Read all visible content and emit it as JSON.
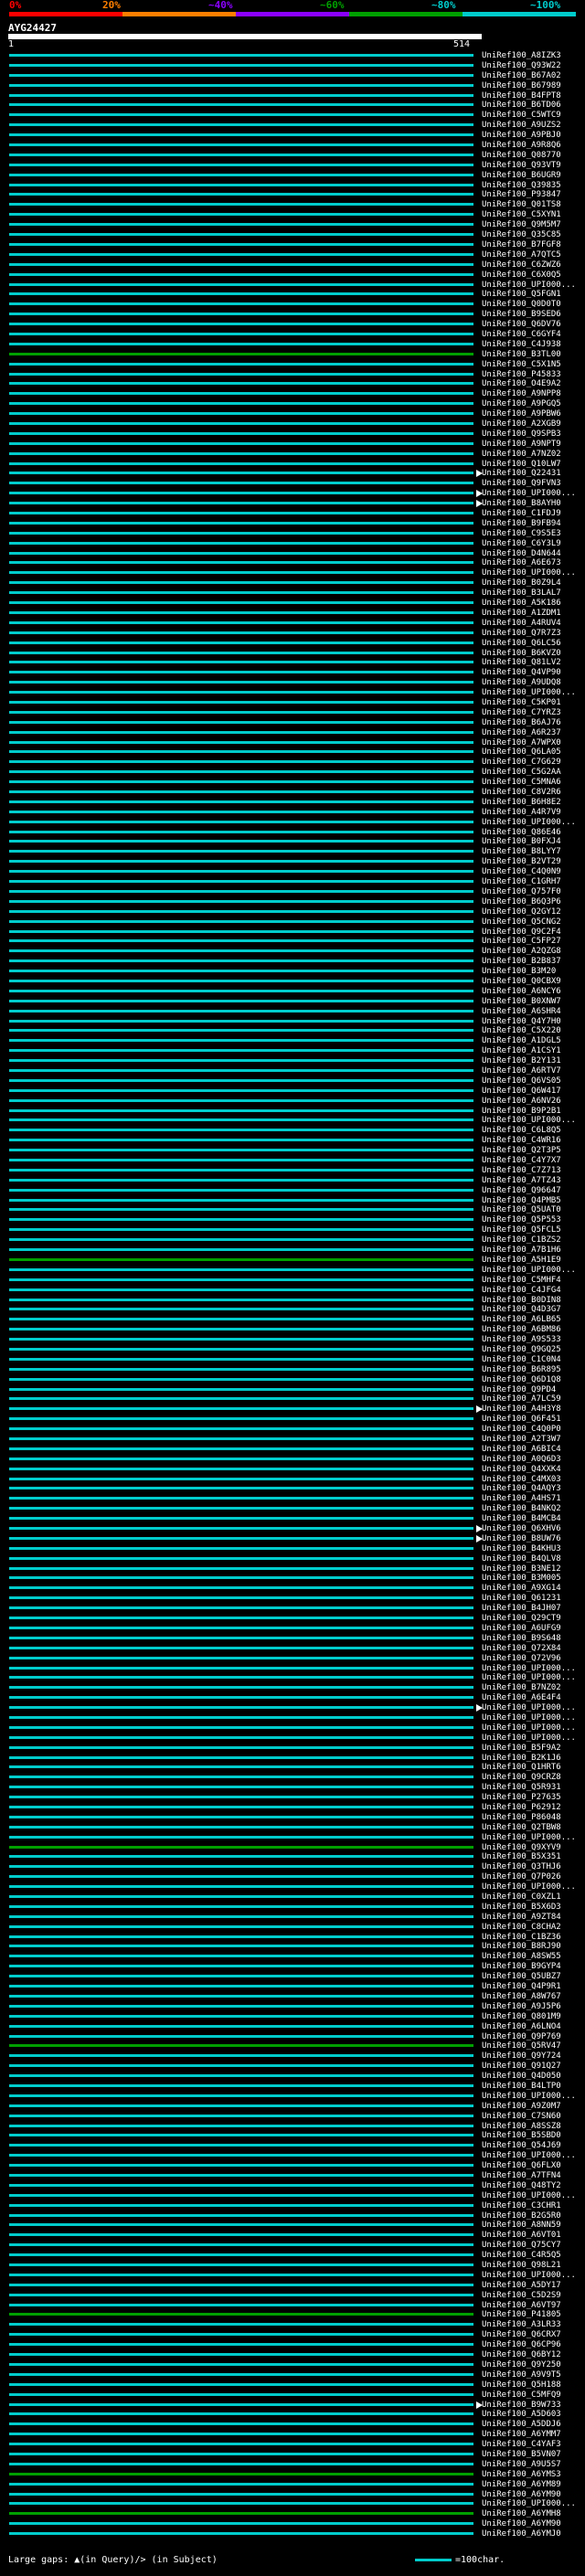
{
  "scale": {
    "labels": [
      "0%",
      "20%",
      "~40%",
      "~60%",
      "~80%",
      "~100%"
    ],
    "colors": [
      "#ff0000",
      "#ff7f00",
      "#8b00ff",
      "#00a000",
      "#00cccc"
    ]
  },
  "query": {
    "id": "AYG24427",
    "start": "1",
    "end": "514"
  },
  "hits": [
    "UniRef100_A8IZK3",
    "UniRef100_Q93W22",
    "UniRef100_B67A02",
    "UniRef100_B67989",
    "UniRef100_B4FPT8",
    "UniRef100_B6TD06",
    "UniRef100_C5WTC9",
    "UniRef100_A9UZS2",
    "UniRef100_A9PBJ0",
    "UniRef100_A9R8Q6",
    "UniRef100_Q08770",
    "UniRef100_Q93VT9",
    "UniRef100_B6UGR9",
    "UniRef100_Q39835",
    "UniRef100_P93847",
    "UniRef100_Q01TS8",
    "UniRef100_C5XYN1",
    "UniRef100_Q9M5M7",
    "UniRef100_Q35C85",
    "UniRef100_B7FGF8",
    "UniRef100_A7QTC5",
    "UniRef100_C6ZWZ6",
    "UniRef100_C6X0Q5",
    "UniRef100_UPI000...",
    "UniRef100_Q5FGN1",
    "UniRef100_Q0D0T0",
    "UniRef100_B9SED6",
    "UniRef100_Q6DV76",
    "UniRef100_C6GYF4",
    "UniRef100_C4J938",
    "UniRef100_B3TL00",
    "UniRef100_C5X1N5",
    "UniRef100_P45833",
    "UniRef100_O4E9A2",
    "UniRef100_A9NPP8",
    "UniRef100_A9PGQ5",
    "UniRef100_A9PBW6",
    "UniRef100_A2XGB9",
    "UniRef100_Q9SPB3",
    "UniRef100_A9NPT9",
    "UniRef100_A7NZ02",
    "UniRef100_Q10LW7",
    "UniRef100_Q22431",
    "UniRef100_Q9FVN3",
    "UniRef100_UPI000...",
    "UniRef100_B8AYH0",
    "UniRef100_C1FDJ9",
    "UniRef100_B9FB94",
    "UniRef100_C9S5E3",
    "UniRef100_C6Y3L9",
    "UniRef100_D4N644",
    "UniRef100_A6E673",
    "UniRef100_UPI000...",
    "UniRef100_B0Z9L4",
    "UniRef100_B3LAL7",
    "UniRef100_A5K186",
    "UniRef100_A1ZDM1",
    "UniRef100_A4RUV4",
    "UniRef100_Q7R7Z3",
    "UniRef100_Q6LC56",
    "UniRef100_B6KVZ0",
    "UniRef100_Q81LV2",
    "UniRef100_Q4VP90",
    "UniRef100_A9UDQ8",
    "UniRef100_UPI000...",
    "UniRef100_C5KP01",
    "UniRef100_C7YRZ3",
    "UniRef100_B6AJ76",
    "UniRef100_A6R237",
    "UniRef100_A7WPX0",
    "UniRef100_Q6LA05",
    "UniRef100_C7G629",
    "UniRef100_C5G2AA",
    "UniRef100_C5MNA6",
    "UniRef100_C8V2R6",
    "UniRef100_B6H8E2",
    "UniRef100_A4R7V9",
    "UniRef100_UPI000...",
    "UniRef100_Q86E46",
    "UniRef100_B0FXJ4",
    "UniRef100_B8LYY7",
    "UniRef100_B2VT29",
    "UniRef100_C4Q0N9",
    "UniRef100_C1GRH7",
    "UniRef100_Q757F0",
    "UniRef100_B6Q3P6",
    "UniRef100_Q2GY12",
    "UniRef100_Q5CNG2",
    "UniRef100_Q9C2F4",
    "UniRef100_C5FP27",
    "UniRef100_A2QZG8",
    "UniRef100_B2B837",
    "UniRef100_B3M20",
    "UniRef100_Q0CBX9",
    "UniRef100_A6NCY6",
    "UniRef100_B0XNW7",
    "UniRef100_A6SHR4",
    "UniRef100_Q4Y7H0",
    "UniRef100_C5X220",
    "UniRef100_A1DGL5",
    "UniRef100_A1CSY1",
    "UniRef100_B2Y131",
    "UniRef100_A6RTV7",
    "UniRef100_Q6VS05",
    "UniRef100_Q6W417",
    "UniRef100_A6NV26",
    "UniRef100_B9P2B1",
    "UniRef100_UPI000...",
    "UniRef100_C6L8Q5",
    "UniRef100_C4WR16",
    "UniRef100_Q2T3P5",
    "UniRef100_C4Y7X7",
    "UniRef100_C7Z713",
    "UniRef100_A7TZ43",
    "UniRef100_Q96647",
    "UniRef100_Q4PMB5",
    "UniRef100_Q5UAT0",
    "UniRef100_Q5P553",
    "UniRef100_Q5FCL5",
    "UniRef100_C1BZS2",
    "UniRef100_A7B1H6",
    "UniRef100_A5H1E9",
    "UniRef100_UPI000...",
    "UniRef100_C5MHF4",
    "UniRef100_C4JFG4",
    "UniRef100_B0DIN8",
    "UniRef100_Q4D3G7",
    "UniRef100_A6LB65",
    "UniRef100_A6BM86",
    "UniRef100_A9S533",
    "UniRef100_Q9GQ25",
    "UniRef100_C1C0N4",
    "UniRef100_B6R895",
    "UniRef100_Q6D1Q8",
    "UniRef100_Q9PD4",
    "UniRef100_A7LC59",
    "UniRef100_A4H3Y8",
    "UniRef100_Q6F451",
    "UniRef100_C4Q0P0",
    "UniRef100_A2T3W7",
    "UniRef100_A6BIC4",
    "UniRef100_A0Q6D3",
    "UniRef100_Q4XXK4",
    "UniRef100_C4MX03",
    "UniRef100_Q4AQY3",
    "UniRef100_A4HS71",
    "UniRef100_B4NKQ2",
    "UniRef100_B4MCB4",
    "UniRef100_Q6XHV6",
    "UniRef100_B8UW76",
    "UniRef100_B4KHU3",
    "UniRef100_B4QLV8",
    "UniRef100_B3NE12",
    "UniRef100_B3M005",
    "UniRef100_A9XG14",
    "UniRef100_Q61231",
    "UniRef100_B4JH07",
    "UniRef100_Q29CT9",
    "UniRef100_A6UFG9",
    "UniRef100_B9S648",
    "UniRef100_Q72X84",
    "UniRef100_Q72V96",
    "UniRef100_UPI000...",
    "UniRef100_UPI000...",
    "UniRef100_B7NZ02",
    "UniRef100_A6E4F4",
    "UniRef100_UPI000...",
    "UniRef100_UPI000...",
    "UniRef100_UPI000...",
    "UniRef100_UPI000...",
    "UniRef100_B5F9A2",
    "UniRef100_B2K1J6",
    "UniRef100_Q1HRT6",
    "UniRef100_Q9CRZ8",
    "UniRef100_Q5R931",
    "UniRef100_P27635",
    "UniRef100_P62912",
    "UniRef100_P86048",
    "UniRef100_Q2TBW8",
    "UniRef100_UPI000...",
    "UniRef100_Q9XYV9",
    "UniRef100_B5X351",
    "UniRef100_Q3THJ6",
    "UniRef100_Q7P026",
    "UniRef100_UPI000...",
    "UniRef100_C0XZL1",
    "UniRef100_B5X6D3",
    "UniRef100_A9ZT84",
    "UniRef100_C8CHA2",
    "UniRef100_C1BZ36",
    "UniRef100_B8RJ90",
    "UniRef100_A8SW55",
    "UniRef100_B9GYP4",
    "UniRef100_Q5UBZ7",
    "UniRef100_Q4P9R1",
    "UniRef100_A8W767",
    "UniRef100_A9J5P6",
    "UniRef100_Q801M9",
    "UniRef100_A6LNO4",
    "UniRef100_Q9P769",
    "UniRef100_Q5RV47",
    "UniRef100_Q9Y724",
    "UniRef100_Q91Q27",
    "UniRef100_Q4D050",
    "UniRef100_B4LTP0",
    "UniRef100_UPI000...",
    "UniRef100_A9Z0M7",
    "UniRef100_C7SN60",
    "UniRef100_A8SSZ8",
    "UniRef100_B5SBD0",
    "UniRef100_Q54J69",
    "UniRef100_UPI000...",
    "UniRef100_Q6FLX0",
    "UniRef100_A7TFN4",
    "UniRef100_Q48TY2",
    "UniRef100_UPI000...",
    "UniRef100_C3CHR1",
    "UniRef100_B2G5R0",
    "UniRef100_A8NN59",
    "UniRef100_A6VT01",
    "UniRef100_Q75CY7",
    "UniRef100_C4R5Q5",
    "UniRef100_Q98L21",
    "UniRef100_UPI000...",
    "UniRef100_A5DY17",
    "UniRef100_C5D2S9",
    "UniRef100_A6VT97",
    "UniRef100_P41805",
    "UniRef100_A3LR33",
    "UniRef100_Q6CRX7",
    "UniRef100_Q6CP96",
    "UniRef100_Q6BY12",
    "UniRef100_Q9Y250",
    "UniRef100_A9V9T5",
    "UniRef100_Q5H188",
    "UniRef100_C5MFQ9",
    "UniRef100_B9W733",
    "UniRef100_A5D603",
    "UniRef100_A5DDJ6",
    "UniRef100_A6YMM7",
    "UniRef100_C4YAF3",
    "UniRef100_B5VN07",
    "UniRef100_A9U5S7",
    "UniRef100_A6YMS3",
    "UniRef100_A6YM89",
    "UniRef100_A6YM90",
    "UniRef100_UPI000...",
    "UniRef100_A6YMH8",
    "UniRef100_A6YM90",
    "UniRef100_A6YMJ0"
  ],
  "legend": {
    "gaps_text": "Large gaps: ▲(in Query)/> (in Subject)",
    "scale_text": "=100char."
  }
}
